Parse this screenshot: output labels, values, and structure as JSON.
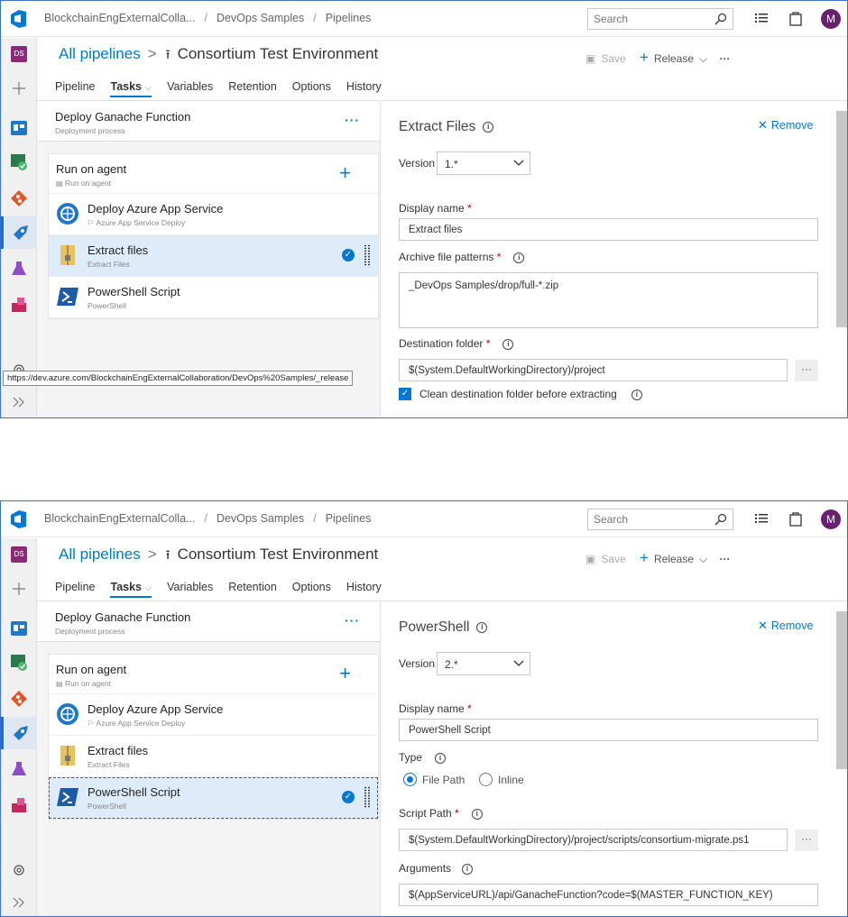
{
  "breadcrumb": [
    "BlockchainEngExternalColla...",
    "DevOps Samples",
    "Pipelines"
  ],
  "search": {
    "placeholder": "Search"
  },
  "user": {
    "initial": "M"
  },
  "project_badge": "DS",
  "header": {
    "all_pipelines": "All pipelines",
    "pipeline_name": "Consortium Test Environment",
    "save_label": "Save",
    "release_label": "Release",
    "more_label": "···"
  },
  "tabs": [
    "Pipeline",
    "Tasks",
    "Variables",
    "Retention",
    "Options",
    "History"
  ],
  "stage": {
    "name": "Deploy Ganache Function",
    "sub": "Deployment process",
    "menu": "···"
  },
  "agent": {
    "name": "Run on agent",
    "sub": "Run on agent"
  },
  "tasks": [
    {
      "name": "Deploy Azure App Service",
      "sub": "Azure App Service Deploy"
    },
    {
      "name": "Extract files",
      "sub": "Extract Files"
    },
    {
      "name": "PowerShell Script",
      "sub": "PowerShell"
    }
  ],
  "tooltip_url": "https://dev.azure.com/BlockchainEngExternalCollaboration/DevOps%20Samples/_release",
  "panel1": {
    "title": "Extract Files",
    "remove": "Remove",
    "version_label": "Version",
    "version": "1.*",
    "display_name_label": "Display name",
    "display_name": "Extract files",
    "archive_label": "Archive file patterns",
    "archive_value": "_DevOps Samples/drop/full-*.zip",
    "dest_label": "Destination folder",
    "dest_value": "$(System.DefaultWorkingDirectory)/project",
    "clean_label": "Clean destination folder before extracting"
  },
  "panel2": {
    "title": "PowerShell",
    "remove": "Remove",
    "version_label": "Version",
    "version": "2.*",
    "display_name_label": "Display name",
    "display_name": "PowerShell Script",
    "type_label": "Type",
    "type_options": [
      "File Path",
      "Inline"
    ],
    "script_path_label": "Script Path",
    "script_path": "$(System.DefaultWorkingDirectory)/project/scripts/consortium-migrate.ps1",
    "arguments_label": "Arguments",
    "arguments": "$(AppServiceURL)/api/GanacheFunction?code=$(MASTER_FUNCTION_KEY)"
  },
  "colors": {
    "accent": "#0078d4",
    "selected_row": "#deecf9",
    "avatar": "#6b1f6f"
  }
}
